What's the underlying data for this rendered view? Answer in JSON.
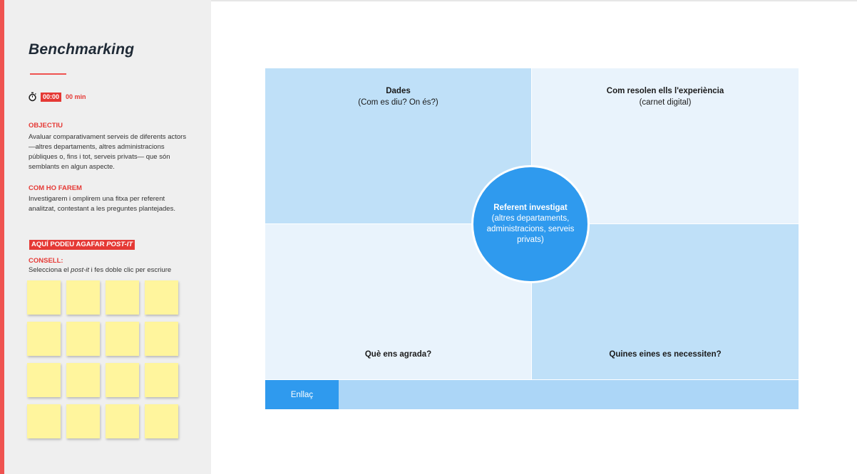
{
  "sidebar": {
    "title": "Benchmarking",
    "timer": {
      "icon": "stopwatch-icon",
      "time": "00:00",
      "minutes": "00 min"
    },
    "objective": {
      "title": "OBJECTIU",
      "text": "Avaluar comparativament serveis de diferents actors —altres departaments, altres administracions públiques o, fins i tot, serveis privats— que són semblants en algun aspecte."
    },
    "method": {
      "title": "COM HO FAREM",
      "text": "Investigarem i omplirem una fitxa per referent analitzat, contestant a les preguntes plantejades."
    },
    "postit": {
      "banner_prefix": "AQUÍ PODEU AGAFAR ",
      "banner_emphasis": "POST-IT",
      "tip_title": "CONSELL:",
      "tip_prefix": "Selecciona el ",
      "tip_emphasis": "post-it",
      "tip_suffix": " i fes doble clic per escriure",
      "count": 16
    }
  },
  "board": {
    "top_left": {
      "title": "Dades",
      "subtitle": "(Com es diu? On és?)"
    },
    "top_right": {
      "title": "Com resolen ells l'experiència",
      "subtitle": "(carnet digital)"
    },
    "bottom_left": {
      "title": "Què ens agrada?"
    },
    "bottom_right": {
      "title": "Quines eines es necessiten?"
    },
    "center": {
      "title": "Referent investigat",
      "subtitle": "(altres departaments, administracions, serveis privats)"
    },
    "link_label": "Enllaç"
  },
  "colors": {
    "accent": "#ef5350",
    "sidebar_bg": "#efefef",
    "quad_dark": "#bfe0f8",
    "quad_light": "#e9f3fc",
    "circle": "#2f9aee",
    "postit": "#fff59d"
  }
}
